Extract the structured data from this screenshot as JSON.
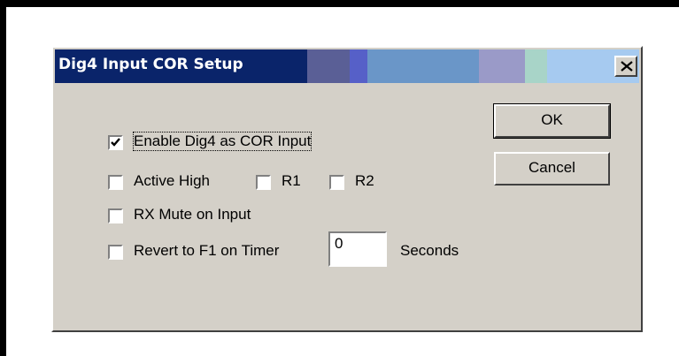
{
  "dialog": {
    "title": "Dig4 Input COR Setup",
    "close_symbol": "close-icon",
    "colors": {
      "face": "#d4d0c8",
      "titlebar_left": "#0a246a",
      "titlebar_right": "#a6caf0"
    }
  },
  "buttons": {
    "ok_label": "OK",
    "cancel_label": "Cancel"
  },
  "options": {
    "enable_dig4": {
      "label": "Enable Dig4 as COR Input",
      "checked": true
    },
    "active_high": {
      "label": "Active High",
      "checked": false
    },
    "r1": {
      "label": "R1",
      "checked": false
    },
    "r2": {
      "label": "R2",
      "checked": false
    },
    "rx_mute": {
      "label": "RX Mute on Input",
      "checked": false
    },
    "revert_f1": {
      "label": "Revert to F1 on Timer",
      "checked": false
    }
  },
  "timer": {
    "value": "0",
    "unit_label": "Seconds"
  }
}
